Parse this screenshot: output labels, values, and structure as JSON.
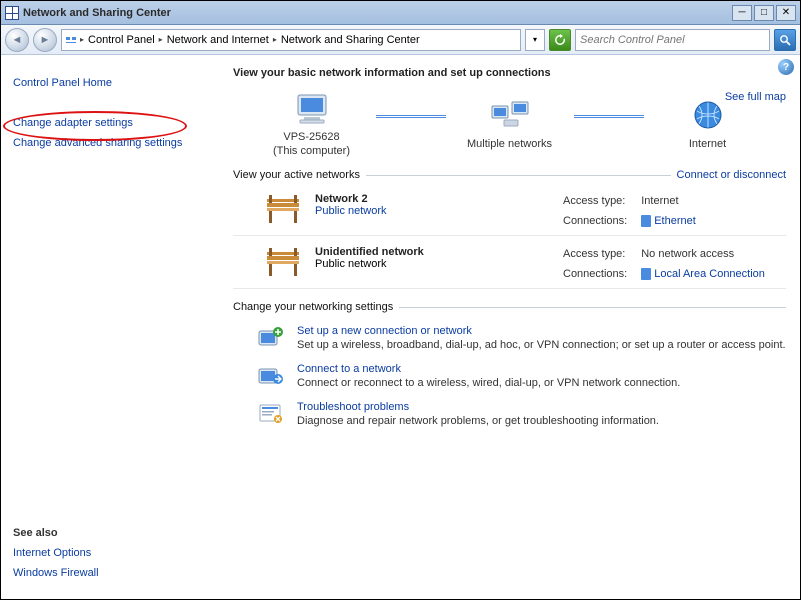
{
  "window": {
    "title": "Network and Sharing Center"
  },
  "breadcrumb": {
    "items": [
      "Control Panel",
      "Network and Internet",
      "Network and Sharing Center"
    ]
  },
  "search": {
    "placeholder": "Search Control Panel"
  },
  "sidebar": {
    "home": "Control Panel Home",
    "change_adapter": "Change adapter settings",
    "change_advanced": "Change advanced sharing settings",
    "see_also_label": "See also",
    "see_also": [
      "Internet Options",
      "Windows Firewall"
    ]
  },
  "main": {
    "heading": "View your basic network information and set up connections",
    "see_full_map": "See full map",
    "map": {
      "this_computer": "VPS-25628",
      "this_computer_sub": "(This computer)",
      "middle": "Multiple networks",
      "right": "Internet"
    },
    "active_section": "View your active networks",
    "connect_link": "Connect or disconnect",
    "networks": [
      {
        "name": "Network  2",
        "type": "Public network",
        "access_label": "Access type:",
        "access_value": "Internet",
        "conn_label": "Connections:",
        "conn_value": "Ethernet"
      },
      {
        "name": "Unidentified network",
        "type": "Public network",
        "access_label": "Access type:",
        "access_value": "No network access",
        "conn_label": "Connections:",
        "conn_value": "Local Area Connection"
      }
    ],
    "change_section": "Change your networking settings",
    "actions": [
      {
        "title": "Set up a new connection or network",
        "desc": "Set up a wireless, broadband, dial-up, ad hoc, or VPN connection; or set up a router or access point."
      },
      {
        "title": "Connect to a network",
        "desc": "Connect or reconnect to a wireless, wired, dial-up, or VPN network connection."
      },
      {
        "title": "Troubleshoot problems",
        "desc": "Diagnose and repair network problems, or get troubleshooting information."
      }
    ]
  }
}
